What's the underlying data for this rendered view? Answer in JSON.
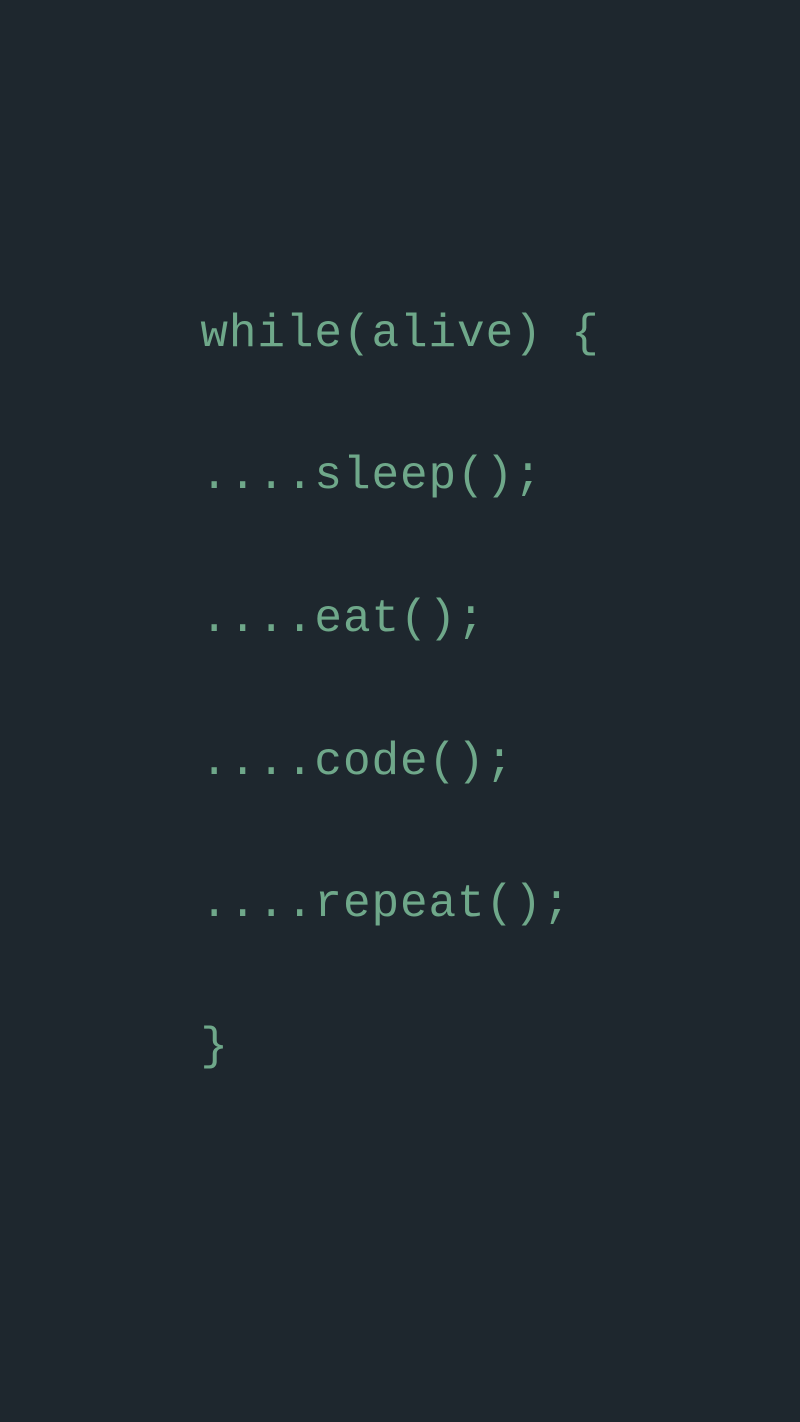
{
  "code": {
    "lines": [
      "while(alive) {",
      "....sleep();",
      "....eat();",
      "....code();",
      "....repeat();",
      "}"
    ]
  },
  "colors": {
    "background": "#1e272e",
    "text": "#6fa88a"
  }
}
